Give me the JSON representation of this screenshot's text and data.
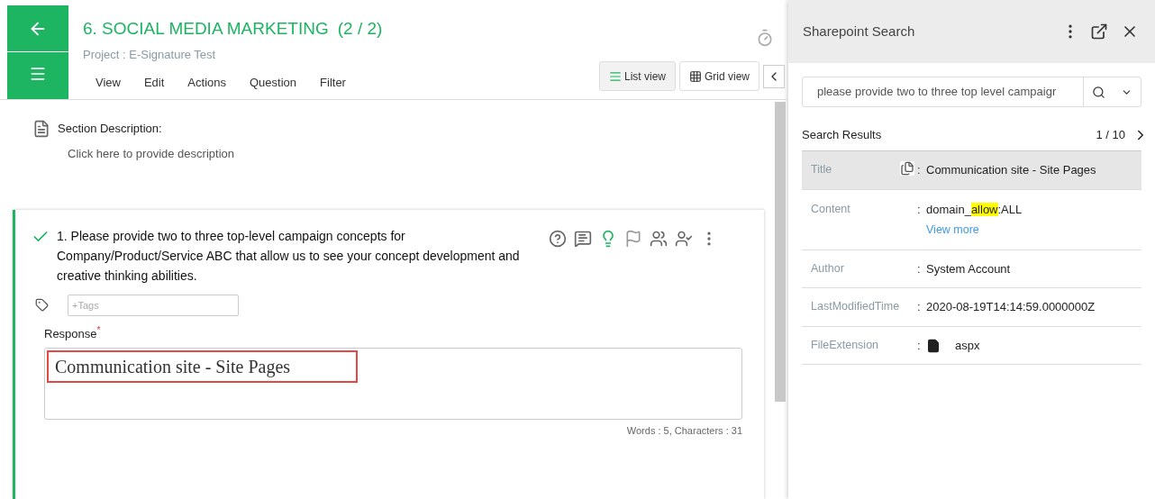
{
  "header": {
    "title": "6. SOCIAL MEDIA MARKETING",
    "count": "(2 / 2)",
    "project": "Project : E-Signature Test",
    "menu": [
      "View",
      "Edit",
      "Actions",
      "Question",
      "Filter"
    ],
    "views": [
      {
        "label": "List view",
        "kind": "list",
        "selected": true
      },
      {
        "label": "Grid view",
        "kind": "grid",
        "selected": false
      }
    ]
  },
  "section": {
    "label": "Section Description:",
    "placeholder": "Click here to provide description"
  },
  "question": {
    "answered": true,
    "text": "1. Please provide two to three top-level campaign concepts for Company/Product/Service ABC that allow us to see your concept development and creative thinking abilities.",
    "tags_placeholder": "+Tags",
    "response_label": "Response",
    "required": true,
    "required_mark": "*",
    "response": "Communication site - Site Pages",
    "counter": "Words : 5, Characters : 31"
  },
  "panel": {
    "title": "Sharepoint Search",
    "query": "please provide two to three top level campaigr",
    "results_label": "Search Results",
    "pager": "1 / 10",
    "separator": ":",
    "rows": [
      {
        "label": "Title",
        "kind": "title",
        "selected": true,
        "parts": [
          {
            "text": "Communication site - Site Pages",
            "highlighted": false
          }
        ]
      },
      {
        "label": "Content",
        "kind": "content",
        "selected": false,
        "parts": [
          {
            "text": "domain_",
            "highlighted": false
          },
          {
            "text": "allow",
            "highlighted": true
          },
          {
            "text": ":ALL",
            "highlighted": false
          }
        ],
        "link": "View more"
      },
      {
        "label": "Author",
        "kind": "text",
        "selected": false,
        "parts": [
          {
            "text": "System Account",
            "highlighted": false
          }
        ]
      },
      {
        "label": "LastModifiedTime",
        "kind": "text",
        "selected": false,
        "parts": [
          {
            "text": "2020-08-19T14:14:59.0000000Z",
            "highlighted": false
          }
        ]
      },
      {
        "label": "FileExtension",
        "kind": "file",
        "selected": false,
        "parts": [
          {
            "text": "aspx",
            "highlighted": false
          }
        ]
      }
    ]
  }
}
